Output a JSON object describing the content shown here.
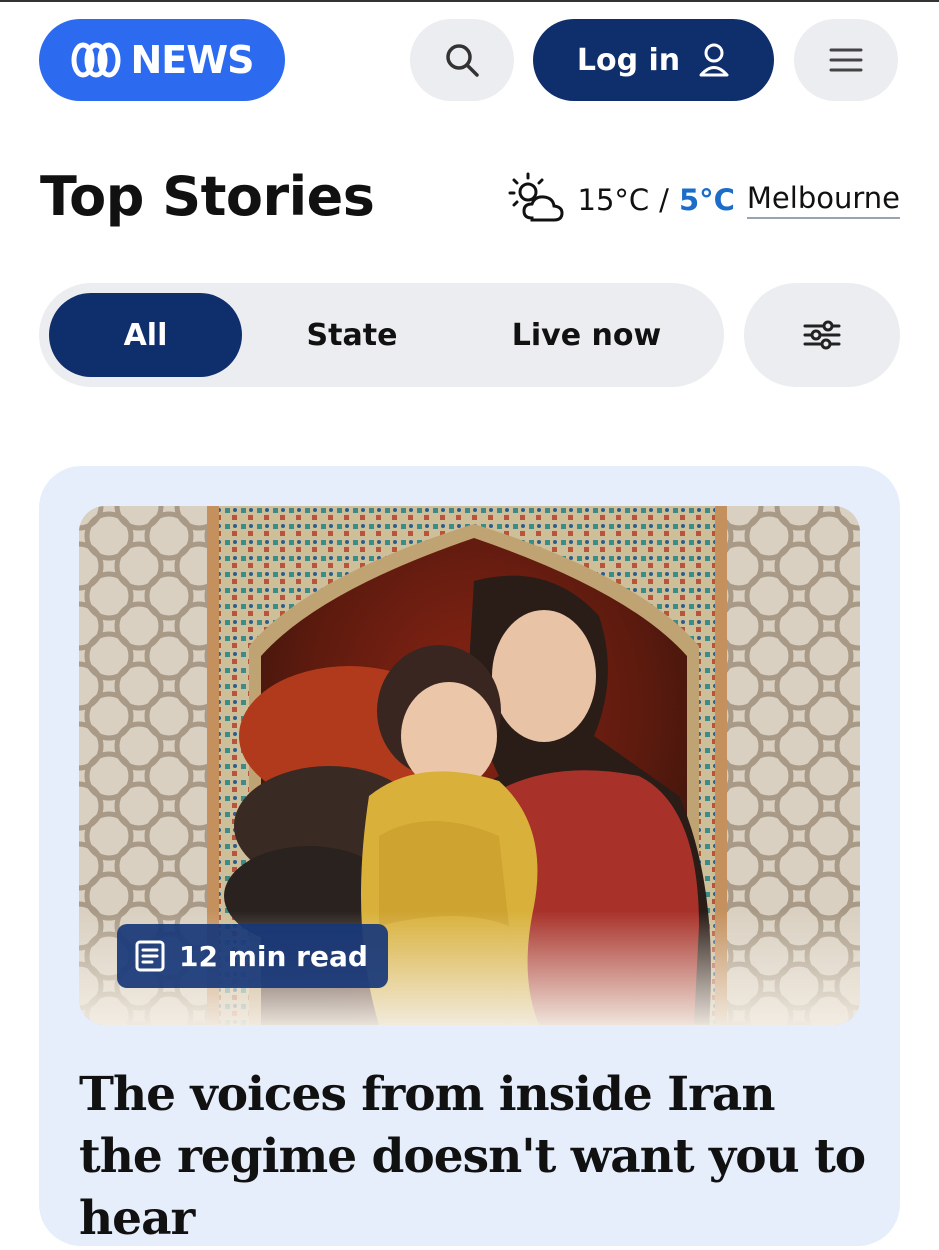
{
  "header": {
    "logo_text": "NEWS",
    "login_label": "Log in"
  },
  "icons": {
    "logo": "abc-logo-icon",
    "search": "search-icon",
    "user": "user-icon",
    "menu": "hamburger-menu-icon",
    "weather": "partly-cloudy-sunny-icon",
    "filter": "sliders-icon",
    "article": "article-document-icon"
  },
  "page": {
    "title": "Top Stories"
  },
  "weather": {
    "max": "15°C",
    "separator": "/",
    "min": "5°C",
    "location": "Melbourne"
  },
  "tabs": [
    {
      "label": "All",
      "active": true
    },
    {
      "label": "State",
      "active": false
    },
    {
      "label": "Live now",
      "active": false
    }
  ],
  "story": {
    "read_time": "12 min read",
    "headline": "The voices from inside Iran the regime doesn't want you to hear"
  },
  "colors": {
    "brand_blue": "#2c6bef",
    "navy": "#0f2e6c",
    "pill_grey": "#ecedf0",
    "card_bg": "#e6eefb",
    "min_temp_blue": "#1c6dc9"
  }
}
